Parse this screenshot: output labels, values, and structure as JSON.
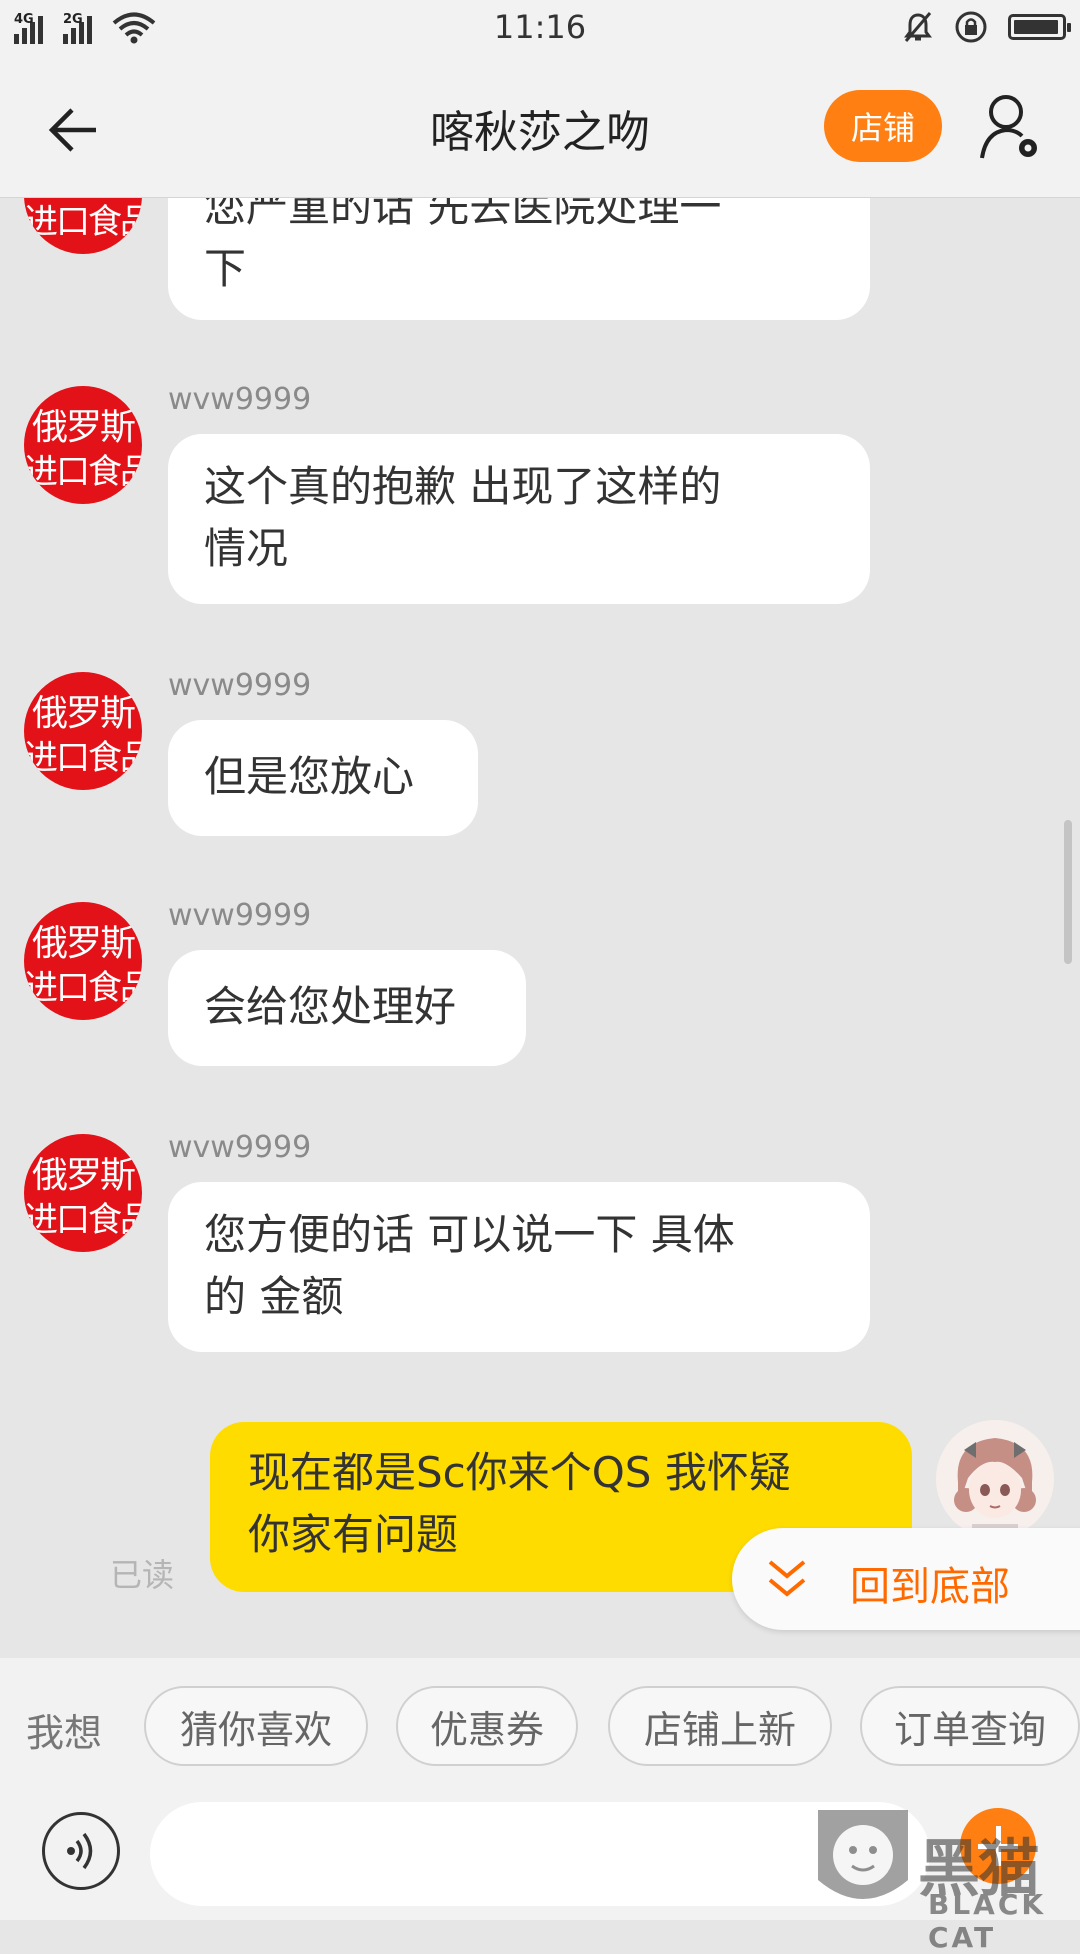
{
  "status_bar": {
    "time": "11:16",
    "network_1": "4G",
    "network_2": "2G",
    "battery_level": 0.9,
    "icons": [
      "signal-icon",
      "wifi-icon",
      "mute-icon",
      "rotation-lock-icon",
      "battery-icon"
    ]
  },
  "header": {
    "title": "喀秋莎之吻",
    "shop_button": "店铺",
    "icons": [
      "back-arrow-icon",
      "profile-settings-icon"
    ]
  },
  "messages": [
    {
      "sender": "",
      "text_line1": "您严重的话 先去医院处理一",
      "text_line2": "下"
    },
    {
      "sender": "wvw9999",
      "text_line1": "这个真的抱歉 出现了这样的",
      "text_line2": "情况"
    },
    {
      "sender": "wvw9999",
      "text_line1": "但是您放心"
    },
    {
      "sender": "wvw9999",
      "text_line1": "会给您处理好"
    },
    {
      "sender": "wvw9999",
      "text_line1": "您方便的话 可以说一下 具体",
      "text_line2": "的 金额"
    }
  ],
  "my_message": {
    "text_line1": "现在都是Sc你来个QS 我怀疑",
    "text_line2": "你家有问题",
    "status": "已读"
  },
  "seller_avatar": {
    "line1": "俄罗斯",
    "line2": "进口食品",
    "color": "#e31218"
  },
  "back_to_bottom": "回到底部",
  "quick_actions": {
    "label": "我想",
    "chips": [
      "猜你喜欢",
      "优惠券",
      "店铺上新",
      "订单查询"
    ]
  },
  "input": {
    "placeholder": ""
  },
  "watermark": {
    "main": "黑猫",
    "sub": "BLACK CAT"
  },
  "colors": {
    "accent": "#ff7f12",
    "my_bubble": "#ffdc00",
    "background": "#e6e6e6"
  }
}
